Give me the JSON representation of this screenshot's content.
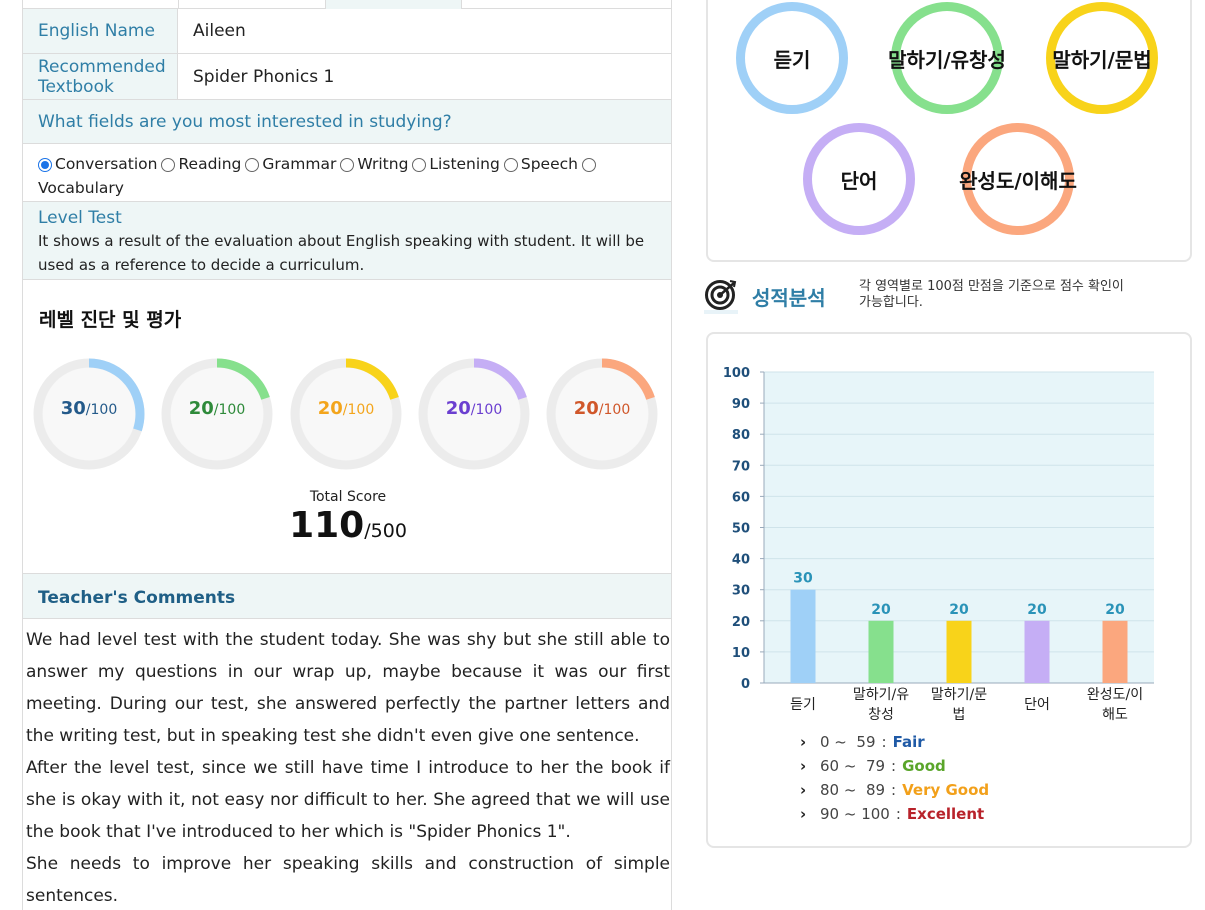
{
  "profile": {
    "english_name_label": "English Name",
    "english_name_value": "Aileen",
    "textbook_label_line1": "Recommended",
    "textbook_label_line2": "Textbook",
    "textbook_value": "Spider Phonics 1"
  },
  "interests": {
    "question": "What fields are you most interested in studying?",
    "options": [
      {
        "label": "Conversation",
        "checked": true
      },
      {
        "label": "Reading",
        "checked": false
      },
      {
        "label": "Grammar",
        "checked": false
      },
      {
        "label": "Writng",
        "checked": false
      },
      {
        "label": "Listening",
        "checked": false
      },
      {
        "label": "Speech",
        "checked": false
      },
      {
        "label": "Vocabulary",
        "checked": false
      }
    ]
  },
  "level_test": {
    "title": "Level Test",
    "description": "It shows a result of the evaluation about English speaking with student. It will be used as a reference to decide a curriculum."
  },
  "evaluation": {
    "title": "레벨 진단 및 평가",
    "scores": [
      {
        "value": "30",
        "max": "/100",
        "color": "#9fd0f7",
        "text_color": "#245a8a",
        "fraction": 0.3
      },
      {
        "value": "20",
        "max": "/100",
        "color": "#86e08d",
        "text_color": "#2e8a3a",
        "fraction": 0.2
      },
      {
        "value": "20",
        "max": "/100",
        "color": "#f8d31a",
        "text_color": "#f3a51c",
        "fraction": 0.2
      },
      {
        "value": "20",
        "max": "/100",
        "color": "#c5aef5",
        "text_color": "#6b3fd0",
        "fraction": 0.2
      },
      {
        "value": "20",
        "max": "/100",
        "color": "#fba77e",
        "text_color": "#d0572a",
        "fraction": 0.2
      }
    ],
    "total_label": "Total Score",
    "total_value": "110",
    "total_max": "/500"
  },
  "comments": {
    "title": "Teacher's Comments",
    "paragraphs": [
      "We had level test with the student today. She was shy but she still able to answer my questions in our wrap up, maybe because it was our first meeting. During our test, she answered perfectly the partner letters and the writing test, but in speaking test she didn't even give one sentence.",
      "After the level test, since we still have time I introduce to her the book if she is okay with it, not easy nor difficult to her. She agreed that we will use the book that I've introduced to her which is \"Spider Phonics 1\".",
      "She needs to improve her speaking skills and construction of simple sentences."
    ]
  },
  "categories": [
    {
      "label": "듣기",
      "color": "#9fd0f7"
    },
    {
      "label": "말하기/유창성",
      "color": "#86e08d"
    },
    {
      "label": "말하기/문법",
      "color": "#f8d31a"
    },
    {
      "label": "단어",
      "color": "#c5aef5"
    },
    {
      "label": "완성도/이해도",
      "color": "#fba77e"
    }
  ],
  "analysis": {
    "title": "성적분석",
    "desc_line1": "각 영역별로 100점 만점을 기준으로 점수 확인이",
    "desc_line2": "가능합니다.",
    "icon": "target-icon"
  },
  "chart_data": {
    "type": "bar",
    "categories": [
      "듣기",
      "말하기/유창성",
      "말하기/문법",
      "단어",
      "완성도/이해도"
    ],
    "category_lines": [
      [
        "듣기"
      ],
      [
        "말하기/유",
        "창성"
      ],
      [
        "말하기/문",
        "법"
      ],
      [
        "단어"
      ],
      [
        "완성도/이",
        "해도"
      ]
    ],
    "values": [
      30,
      20,
      20,
      20,
      20
    ],
    "bar_colors": [
      "#9fd0f7",
      "#86e08d",
      "#f8d31a",
      "#c5aef5",
      "#fba77e"
    ],
    "ylim": [
      0,
      100
    ],
    "yticks": [
      0,
      10,
      20,
      30,
      40,
      50,
      60,
      70,
      80,
      90,
      100
    ],
    "grid": true
  },
  "grades": [
    {
      "range": "0 ~  59",
      "label": "Fair",
      "color": "#1f5aa6"
    },
    {
      "range": "60 ~  79",
      "label": "Good",
      "color": "#5aa52a"
    },
    {
      "range": "80 ~  89",
      "label": "Very Good",
      "color": "#f2a01a"
    },
    {
      "range": "90 ~ 100",
      "label": "Excellent",
      "color": "#b8222a"
    }
  ]
}
